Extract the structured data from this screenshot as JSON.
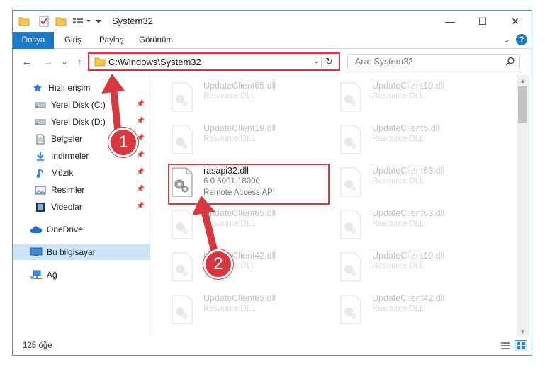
{
  "window": {
    "title": "System32",
    "min_glyph": "—",
    "max_glyph": "☐",
    "close_glyph": "✕"
  },
  "ribbon": {
    "tabs": [
      "Dosya",
      "Giriş",
      "Paylaş",
      "Görünüm"
    ],
    "help_glyph": "?",
    "expand_glyph": "⌄"
  },
  "nav": {
    "address": "C:\\Windows\\System32",
    "search_placeholder": "Ara: System32",
    "back_glyph": "←",
    "forward_glyph": "→",
    "recent_glyph": "⌄",
    "up_glyph": "↑",
    "drop_glyph": "⌄",
    "refresh_glyph": "↻"
  },
  "sidebar": {
    "items": [
      {
        "label": "Hızlı erişim",
        "icon": "star-icon",
        "pinned": false
      },
      {
        "label": "Yerel Disk (C:)",
        "icon": "drive-icon",
        "pinned": true
      },
      {
        "label": "Yerel Disk (D:)",
        "icon": "drive-icon",
        "pinned": true
      },
      {
        "label": "Belgeler",
        "icon": "document-icon",
        "pinned": true
      },
      {
        "label": "İndirmeler",
        "icon": "download-icon",
        "pinned": true
      },
      {
        "label": "Müzik",
        "icon": "music-icon",
        "pinned": true
      },
      {
        "label": "Resimler",
        "icon": "pictures-icon",
        "pinned": true
      },
      {
        "label": "Videolar",
        "icon": "video-icon",
        "pinned": true
      },
      {
        "label": "OneDrive",
        "icon": "cloud-icon",
        "pinned": false
      },
      {
        "label": "Bu bilgisayar",
        "icon": "computer-icon",
        "pinned": false
      },
      {
        "label": "Ağ",
        "icon": "network-icon",
        "pinned": false
      }
    ]
  },
  "files": {
    "left": [
      {
        "name": "UpdateClient65.dll",
        "desc": "Resource DLL"
      },
      {
        "name": "UpdateClient19.dll",
        "desc": "Resource DLL"
      },
      {
        "name": "rasapi32.dll",
        "desc": "6.0.6001.18000",
        "desc2": "Remote Access API"
      },
      {
        "name": "UpdateClient65.dll",
        "desc": "Resource DLL"
      },
      {
        "name": "UpdateClient42.dll",
        "desc": "Resource DLL"
      },
      {
        "name": "UpdateClient65.dll",
        "desc": "Resource DLL"
      }
    ],
    "right": [
      {
        "name": "UpdateClient19.dll",
        "desc": "Resource DLL"
      },
      {
        "name": "UpdateClient5.dll",
        "desc": "Resource DLL"
      },
      {
        "name": "UpdateClient63.dll",
        "desc": "Resource DLL"
      },
      {
        "name": "UpdateClient63.dll",
        "desc": "Resource DLL"
      },
      {
        "name": "UpdateClient19.dll",
        "desc": "Resource DLL"
      },
      {
        "name": "UpdateClient42.dll",
        "desc": "Resource DLL"
      }
    ]
  },
  "status": {
    "item_count": "125 öğe"
  },
  "callouts": {
    "one": "1",
    "two": "2"
  },
  "colors": {
    "accent": "#1979ca",
    "highlight": "#d9363e",
    "selected": "#cce4f7"
  }
}
